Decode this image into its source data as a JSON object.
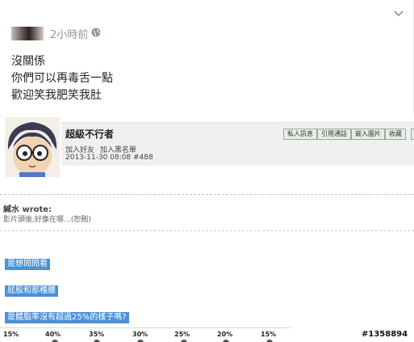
{
  "post": {
    "timestamp": "2小時前",
    "lines": [
      "沒關係",
      "你們可以再毒舌一點",
      "歡迎笑我肥笑我肚"
    ]
  },
  "forum": {
    "username": "超級不行者",
    "links": [
      "加入好友",
      "加入黑名單"
    ],
    "meta": "2013-11-30 08:08 #488",
    "buttons": [
      "私人訊息",
      "引用通話",
      "嵌入圖片",
      "收藏"
    ],
    "quote_author": "緘水 wrote:",
    "quote_text": "影片頭後,好像在哪…(恕刪)",
    "highlights": [
      "是想問問看",
      "屁股和那種腰",
      "是體脂率沒有超過25%的樣子嗎?"
    ],
    "poll_values": [
      "15%",
      "40%",
      "35%",
      "30%",
      "25%",
      "20%",
      "15%"
    ]
  },
  "watermark": "#1358894",
  "colors": {
    "highlight": "#4a90d9",
    "meta_gray": "#90949c"
  },
  "icons": [
    "chevron-down-icon",
    "globe-icon"
  ]
}
